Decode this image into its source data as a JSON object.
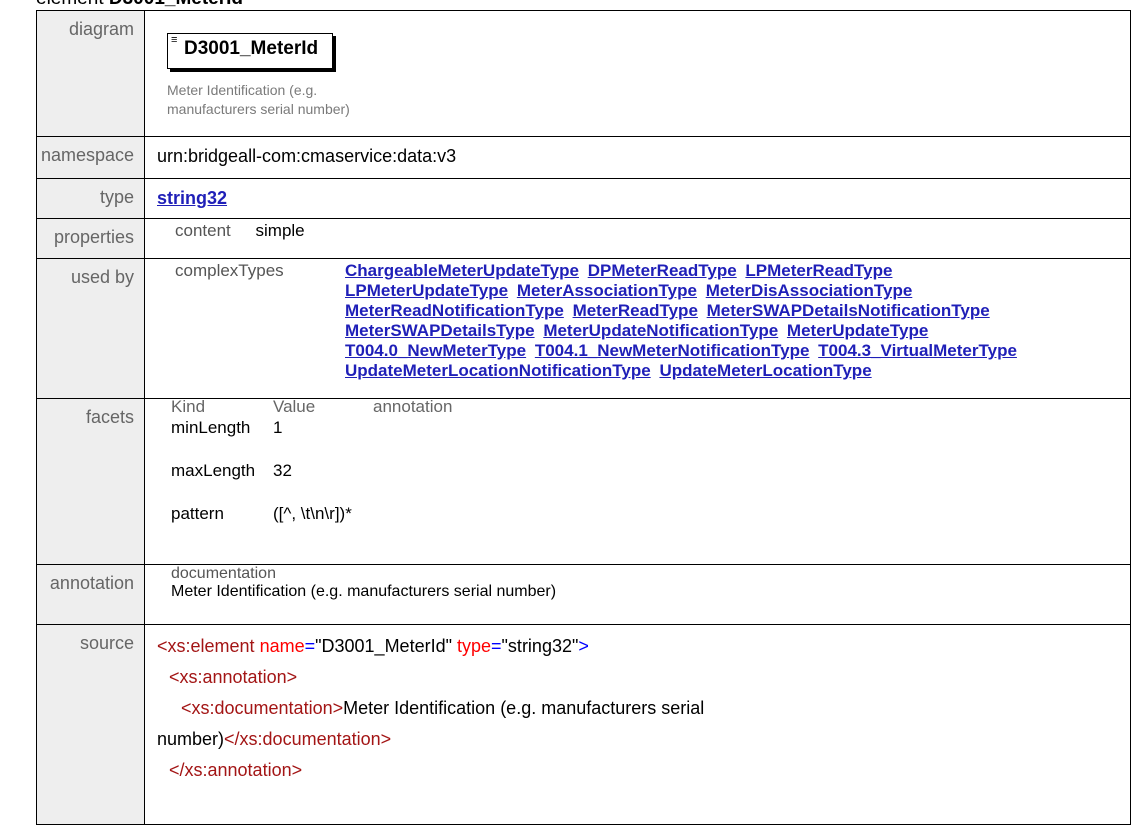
{
  "page": {
    "title_prefix": "element",
    "title_name": "D3001_MeterId"
  },
  "labels": {
    "diagram": "diagram",
    "namespace": "namespace",
    "type": "type",
    "properties": "properties",
    "used_by": "used by",
    "facets": "facets",
    "annotation": "annotation",
    "source": "source"
  },
  "diagram": {
    "element_name": "D3001_MeterId",
    "doc_line1": "Meter Identification (e.g.",
    "doc_line2": "manufacturers serial number)"
  },
  "namespace": "urn:bridgeall-com:cmaservice:data:v3",
  "type_link": "string32",
  "properties": {
    "key": "content",
    "value": "simple"
  },
  "used_by": {
    "category": "complexTypes",
    "links": [
      "ChargeableMeterUpdateType",
      "DPMeterReadType",
      "LPMeterReadType",
      "LPMeterUpdateType",
      "MeterAssociationType",
      "MeterDisAssociationType",
      "MeterReadNotificationType",
      "MeterReadType",
      "MeterSWAPDetailsNotificationType",
      "MeterSWAPDetailsType",
      "MeterUpdateNotificationType",
      "MeterUpdateType",
      "T004.0_NewMeterType",
      "T004.1_NewMeterNotificationType",
      "T004.3_VirtualMeterType",
      "UpdateMeterLocationNotificationType",
      "UpdateMeterLocationType"
    ]
  },
  "facets": {
    "headers": [
      "Kind",
      "Value",
      "annotation"
    ],
    "rows": [
      {
        "kind": "minLength",
        "value": "1"
      },
      {
        "kind": "maxLength",
        "value": "32"
      },
      {
        "kind": "pattern",
        "value": "([^, \\t\\n\\r])*"
      }
    ]
  },
  "annotation": {
    "key": "documentation",
    "text": "Meter Identification (e.g. manufacturers serial number)"
  },
  "source": {
    "line1_open": "<xs:element",
    "line1_attr1": "name",
    "line1_val1": "\"D3001_MeterId\"",
    "line1_attr2": "type",
    "line1_val2": "\"string32\"",
    "line1_close": ">",
    "line2": "<xs:annotation>",
    "line3_open": "<xs:documentation>",
    "line3_text": "Meter Identification (e.g. manufacturers serial",
    "line4_text": "number)",
    "line4_close": "</xs:documentation>",
    "line5": "</xs:annotation>"
  }
}
